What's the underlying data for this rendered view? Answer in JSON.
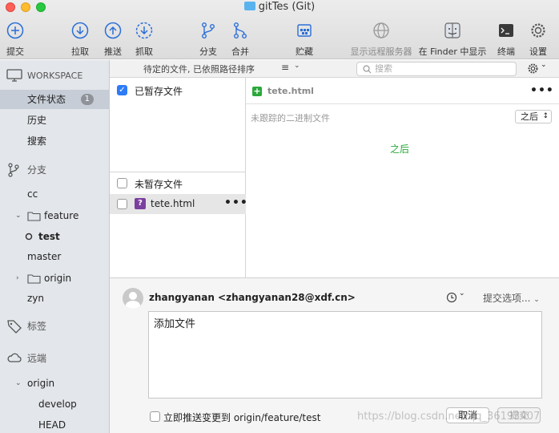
{
  "window": {
    "title": "gitTes (Git)"
  },
  "toolbar": {
    "commit": "提交",
    "pull": "拉取",
    "push": "推送",
    "fetch": "抓取",
    "branch": "分支",
    "merge": "合并",
    "stash": "贮藏",
    "remote": "显示远程服务器",
    "finder": "在 Finder 中显示",
    "terminal": "终端",
    "settings": "设置"
  },
  "sidebar": {
    "workspace": "WORKSPACE",
    "file_status": "文件状态",
    "file_status_count": "1",
    "history": "历史",
    "search": "搜索",
    "branches": "分支",
    "branch_items": [
      "cc",
      "feature",
      "test",
      "master",
      "origin",
      "zyn"
    ],
    "tags": "标签",
    "remotes": "远端",
    "remote_origin": "origin",
    "remote_items": [
      "develop",
      "HEAD"
    ]
  },
  "filelist": {
    "sort_label": "待定的文件, 已依照路径排序",
    "staged_label": "已暂存文件",
    "unstaged_label": "未暂存文件",
    "unstaged_files": [
      {
        "name": "tete.html"
      }
    ]
  },
  "search": {
    "placeholder": "搜索"
  },
  "diff": {
    "file_name": "tete.html",
    "untracked_text": "未跟踪的二进制文件",
    "view_select": "之后",
    "after_label": "之后"
  },
  "commit": {
    "author": "zhangyanan <zhangyanan28@xdf.cn>",
    "options_label": "提交选项...",
    "message": "添加文件",
    "push_label": "立即推送变更到 origin/feature/test",
    "cancel": "取消",
    "submit": "提交"
  },
  "watermark": "https://blog.csdn.net/qq_36193407",
  "colors": {
    "accent": "#2d7bf6",
    "added": "#2aa83a",
    "sidebar_bg": "#e3e6ea",
    "selected_row": "#c6cdd6"
  }
}
